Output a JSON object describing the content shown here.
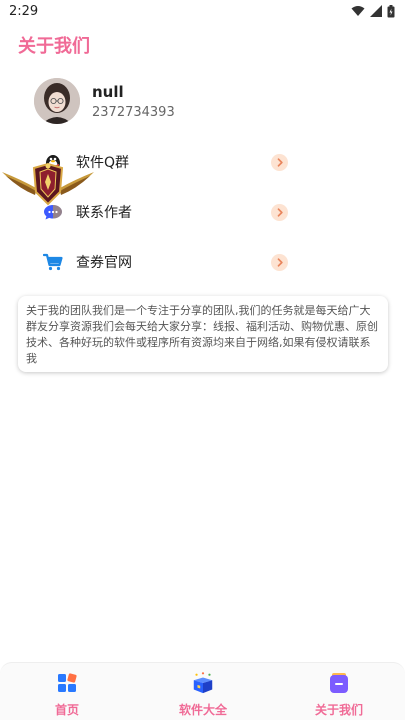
{
  "status_bar": {
    "time": "2:29"
  },
  "page": {
    "title": "关于我们"
  },
  "profile": {
    "name": "null",
    "id": "2372734393"
  },
  "menu": [
    {
      "label": "软件Q群",
      "icon": "qq-penguin-icon"
    },
    {
      "label": "联系作者",
      "icon": "chat-bubble-icon"
    },
    {
      "label": "查券官网",
      "icon": "shopping-cart-icon"
    }
  ],
  "about": {
    "text": "关于我的团队我们是一个专注于分享的团队,我们的任务就是每天给广大群友分享资源我们会每天给大家分享：线报、福利活动、购物优惠、原创技术、各种好玩的软件或程序所有资源均来自于网络,如果有侵权请联系我"
  },
  "bottom_nav": [
    {
      "label": "首页",
      "icon": "home-grid-icon"
    },
    {
      "label": "软件大全",
      "icon": "gift-box-icon"
    },
    {
      "label": "关于我们",
      "icon": "about-card-icon"
    }
  ],
  "colors": {
    "accent": "#f06a96",
    "arrow_bg": "#fde3d2",
    "arrow": "#e8845c"
  }
}
